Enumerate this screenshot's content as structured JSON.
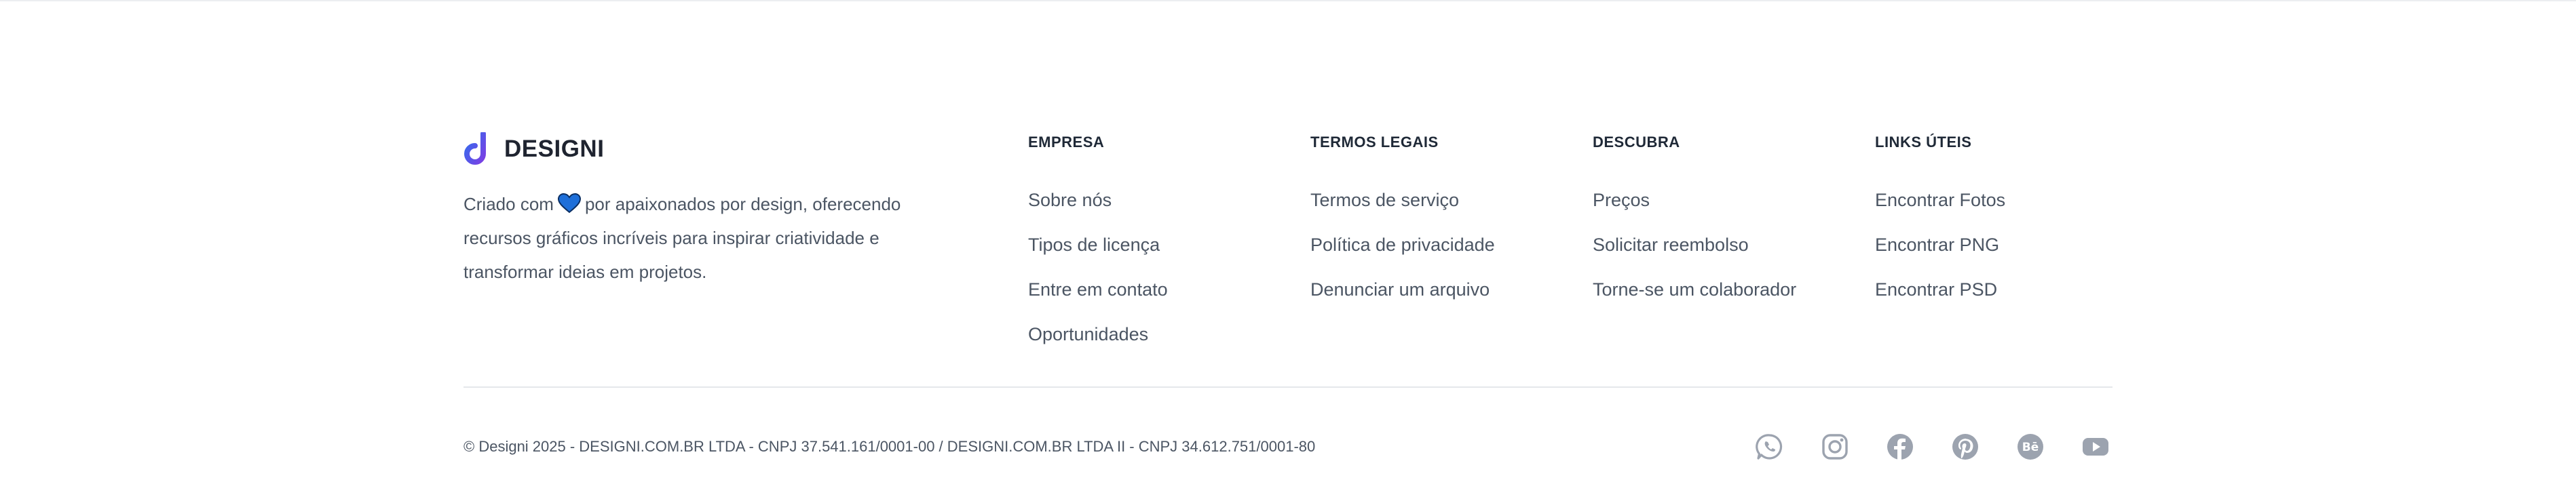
{
  "brand": {
    "name": "DESIGNI",
    "logo_icon": "designi-logo-icon"
  },
  "description": {
    "prefix": "Criado com",
    "icon": "heart-icon",
    "suffix": "por apaixonados por design, oferecendo recursos gráficos incríveis para inspirar criatividade e transformar ideias em projetos."
  },
  "columns": [
    {
      "title": "EMPRESA",
      "links": [
        "Sobre nós",
        "Tipos de licença",
        "Entre em contato",
        "Oportunidades"
      ]
    },
    {
      "title": "TERMOS LEGAIS",
      "links": [
        "Termos de serviço",
        "Política de privacidade",
        "Denunciar um arquivo"
      ]
    },
    {
      "title": "DESCUBRA",
      "links": [
        "Preços",
        "Solicitar reembolso",
        "Torne-se um colaborador"
      ]
    },
    {
      "title": "LINKS ÚTEIS",
      "links": [
        "Encontrar Fotos",
        "Encontrar PNG",
        "Encontrar PSD"
      ]
    }
  ],
  "copyright": "© Designi 2025 - DESIGNI.COM.BR LTDA - CNPJ 37.541.161/0001-00 / DESIGNI.COM.BR LTDA II - CNPJ 34.612.751/0001-80",
  "social": [
    "whatsapp-icon",
    "instagram-icon",
    "facebook-icon",
    "pinterest-icon",
    "behance-icon",
    "youtube-icon"
  ],
  "colors": {
    "icon_gray": "#9ca3af",
    "heading": "#1f2937",
    "text": "#4b5563",
    "logo_blue": "#2f6fed",
    "logo_purple": "#7b3fe4",
    "heart_blue": "#1e6fd9"
  }
}
